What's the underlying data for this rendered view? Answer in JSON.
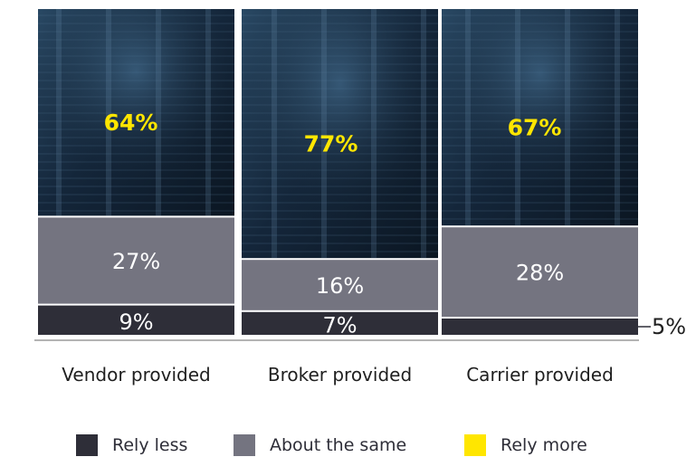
{
  "chart_data": {
    "type": "bar",
    "stacked": true,
    "normalized": true,
    "categories": [
      "Vendor provided",
      "Broker provided",
      "Carrier provided"
    ],
    "series": [
      {
        "name": "Rely less",
        "values": [
          9,
          7,
          5
        ],
        "labels": [
          "9%",
          "7%",
          "5%"
        ],
        "color": "#2e2e38"
      },
      {
        "name": "About the same",
        "values": [
          27,
          16,
          28
        ],
        "labels": [
          "27%",
          "16%",
          "28%"
        ],
        "color": "#747480"
      },
      {
        "name": "Rely more",
        "values": [
          64,
          77,
          67
        ],
        "labels": [
          "64%",
          "77%",
          "67%"
        ],
        "color": "#ffe600"
      }
    ],
    "background": "photo of server room / data center",
    "legend_position": "bottom",
    "grid": false
  }
}
